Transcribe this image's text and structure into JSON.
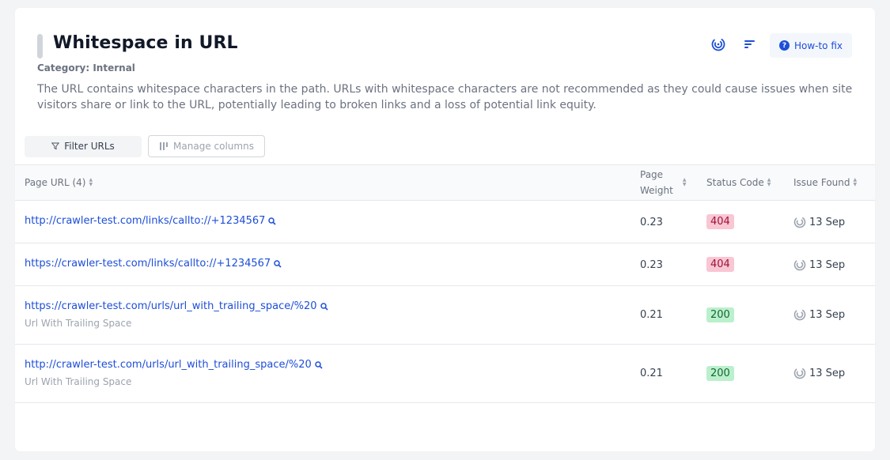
{
  "header": {
    "title": "Whitespace in URL",
    "category_label": "Category:",
    "category_value": "Internal",
    "description": "The URL contains whitespace characters in the path. URLs with whitespace characters are not recommended as they could cause issues when site visitors share or link to the URL, potentially leading to broken links and a loss of potential link equity.",
    "howto_label": "How-to fix",
    "icons": [
      "crawl-icon",
      "sort-lines-icon",
      "question-icon"
    ]
  },
  "toolbar": {
    "filter_label": "Filter URLs",
    "manage_label": "Manage columns"
  },
  "table": {
    "columns": {
      "url": "Page URL (4)",
      "weight_line1": "Page",
      "weight_line2": "Weight",
      "status": "Status Code",
      "issue": "Issue Found"
    },
    "rows": [
      {
        "url": "http://crawler-test.com/links/callto://+1234567",
        "subtitle": "",
        "weight": "0.23",
        "status": "404",
        "issue_found": "13 Sep"
      },
      {
        "url": "https://crawler-test.com/links/callto://+1234567",
        "subtitle": "",
        "weight": "0.23",
        "status": "404",
        "issue_found": "13 Sep"
      },
      {
        "url": "https://crawler-test.com/urls/url_with_trailing_space/%20",
        "subtitle": "Url With Trailing Space",
        "weight": "0.21",
        "status": "200",
        "issue_found": "13 Sep"
      },
      {
        "url": "http://crawler-test.com/urls/url_with_trailing_space/%20",
        "subtitle": "Url With Trailing Space",
        "weight": "0.21",
        "status": "200",
        "issue_found": "13 Sep"
      }
    ]
  },
  "colors": {
    "link": "#1d4ed8",
    "status_error_bg": "#f9c6d4",
    "status_ok_bg": "#bbf0cd"
  }
}
